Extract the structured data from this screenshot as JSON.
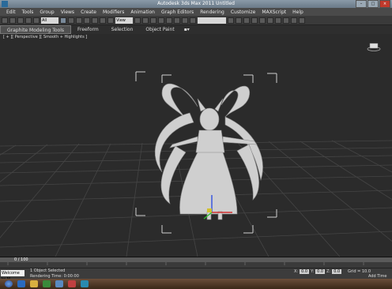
{
  "window": {
    "title": "Autodesk 3ds Max 2011    Untitled"
  },
  "menu": {
    "items": [
      "Edit",
      "Tools",
      "Group",
      "Views",
      "Create",
      "Modifiers",
      "Animation",
      "Graph Editors",
      "Rendering",
      "Customize",
      "MAXScript",
      "Help"
    ]
  },
  "toolbar": {
    "selection_filter": "All",
    "reference_coord": "View"
  },
  "ribbon": {
    "tabs": [
      "Graphite Modeling Tools",
      "Freeform",
      "Selection",
      "Object Paint"
    ]
  },
  "viewport": {
    "label": "[ + ][ Perspective ][ Smooth + Highlights ]"
  },
  "timeline": {
    "frame_counter": "0 / 100"
  },
  "status": {
    "selection": "1 Object Selected",
    "prompt": "Rendering Time: 0:00:00",
    "maxscript_placeholder": "Welcome to M",
    "x_label": "X:",
    "x_value": "0.0",
    "y_label": "Y:",
    "y_value": "0.0",
    "z_label": "Z:",
    "z_value": "0.0",
    "grid": "Grid = 10.0",
    "add_time_tag": "Add Time Tag"
  },
  "colors": {
    "viewport_bg": "#2b2b2b",
    "grid_line": "#4a4a4a",
    "selection_gizmo_x": "#d03030",
    "selection_gizmo_y": "#30c030",
    "selection_gizmo_z": "#3050e0",
    "taskbar": "#4a3322"
  }
}
